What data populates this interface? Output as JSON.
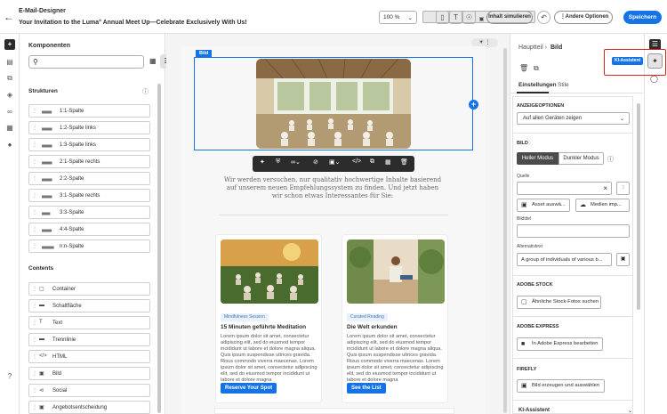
{
  "app": {
    "title": "E-Mail-Designer",
    "subject": "Your Invitation to the Luma° Annual Meet Up—Celebrate Exclusively With Us!"
  },
  "toolbar": {
    "zoom": "100 %",
    "simulate_label": "Inhalt simulieren",
    "more_options_label": "Andere Optionen",
    "save_label": "Speichern"
  },
  "left_panel": {
    "title": "Komponenten",
    "search_placeholder": "",
    "structures_heading": "Strukturen",
    "structures": [
      {
        "label": "1:1-Spalte"
      },
      {
        "label": "1:2-Spalte links"
      },
      {
        "label": "1:3-Spalte links"
      },
      {
        "label": "2:1-Spalte rechts"
      },
      {
        "label": "2:2-Spalte"
      },
      {
        "label": "3:1-Spalte rechts"
      },
      {
        "label": "3:3-Spalte"
      },
      {
        "label": "4:4-Spalte"
      },
      {
        "label": "n:n-Spalte"
      }
    ],
    "contents_heading": "Contents",
    "contents": [
      {
        "label": "Container"
      },
      {
        "label": "Schaltfläche"
      },
      {
        "label": "Text"
      },
      {
        "label": "Trennlinie"
      },
      {
        "label": "HTML"
      },
      {
        "label": "Bild"
      },
      {
        "label": "Social"
      },
      {
        "label": "Angebotsentscheidung"
      }
    ]
  },
  "canvas": {
    "selected_tag": "Bild",
    "intro_text": "Wir werden versuchen, nur qualitativ hochwertige Inhalte basierend auf unserem neuen Empfehlungssystem zu finden. Und jetzt haben wir schon etwas Interessantes für Sie:",
    "cards": [
      {
        "tag": "Mindfulness Session",
        "title": "15 Minuten geführte Meditation",
        "body": "Lorem ipsum dolor sit amet, consectetur adipiscing elit, sed do eiusmod tempor incididunt ut labore et dolore magna aliqua. Quis ipsum suspendisse ultrices gravida. Risus commodo viverra maecenas. Lorem ipsum dolor sit amet, consectetur adipiscing elit, sed do eiusmod tempor incididunt ut labore et dolore magna",
        "button": "Reserve Your Spot"
      },
      {
        "tag": "Curated Reading",
        "title": "Die Welt erkunden",
        "body": "Lorem ipsum dolor sit amet, consectetur adipiscing elit, sed do eiusmod tempor incididunt ut labore et dolore magna aliqua. Quis ipsum suspendisse ultrices gravida. Risus commodo viverra maecenas. Lorem ipsum dolor sit amet, consectetur adipiscing elit, sed do eiusmod tempor incididunt ut labore et dolore magna",
        "button": "See the List"
      }
    ]
  },
  "right_panel": {
    "breadcrumb_root": "Hauptteil",
    "breadcrumb_current": "Bild",
    "tabs": [
      {
        "label": "Einstellungen"
      },
      {
        "label": "Stile"
      }
    ],
    "display_options_heading": "ANZEIGEOPTIONEN",
    "display_select": "Auf allen Geräten zeigen",
    "image_heading": "BILD",
    "mode_light": "Heller Modus",
    "mode_dark": "Dunkler Modus",
    "source_label": "Quelle",
    "asset_button": "Asset auswä...",
    "media_button": "Medien imp...",
    "image_title_label": "Bildtitel",
    "alt_label": "Alternativtext",
    "alt_value": "A group of individuals of various b...",
    "stock_heading": "ADOBE STOCK",
    "stock_button": "Ähnliche Stock-Fotos suchen",
    "express_heading": "ADOBE EXPRESS",
    "express_button": "In Adobe Express bearbeiten",
    "firefly_heading": "FIREFLY",
    "firefly_button": "Bild erzeugen und auswählen",
    "ai_section": "KI-Assistent",
    "ai_badge": "KI-Assistent"
  },
  "colors": {
    "accent": "#1473e6",
    "highlight_frame": "#e0201c"
  }
}
